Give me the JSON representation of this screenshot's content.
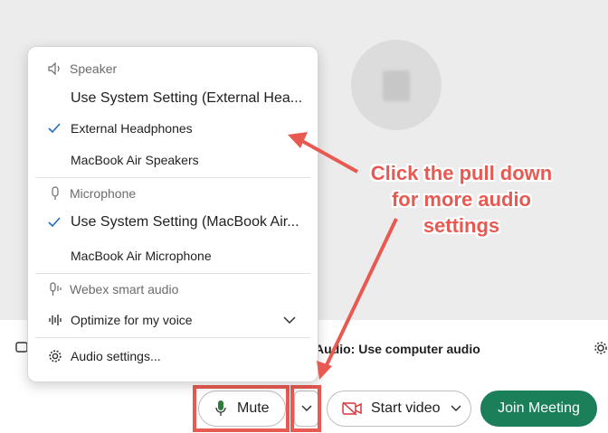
{
  "audio_menu": {
    "speaker_header": "Speaker",
    "speaker_items": [
      {
        "label": "Use System Setting (External Hea...",
        "checked": false
      },
      {
        "label": "External Headphones",
        "checked": true
      },
      {
        "label": "MacBook Air Speakers",
        "checked": false
      }
    ],
    "microphone_header": "Microphone",
    "microphone_items": [
      {
        "label": "Use System Setting (MacBook Air...",
        "checked": true
      },
      {
        "label": "MacBook Air Microphone",
        "checked": false
      }
    ],
    "smart_audio_header": "Webex smart audio",
    "smart_audio_option": "Optimize for my voice",
    "settings_label": "Audio settings..."
  },
  "status": {
    "audio_line": "Audio: Use computer audio"
  },
  "toolbar": {
    "mute_label": "Mute",
    "video_label": "Start video",
    "join_label": "Join Meeting"
  },
  "annotation": {
    "text": "Click the pull down for more audio settings",
    "color": "#e85a51"
  },
  "colors": {
    "accent_join": "#1b7f5a",
    "check": "#1f6fb4",
    "video_off": "#d9363e"
  },
  "icons": [
    "speaker-icon",
    "microphone-icon",
    "smart-audio-icon",
    "waveform-icon",
    "gear-icon",
    "chevron-down-icon",
    "checkmark-icon",
    "video-off-icon"
  ]
}
